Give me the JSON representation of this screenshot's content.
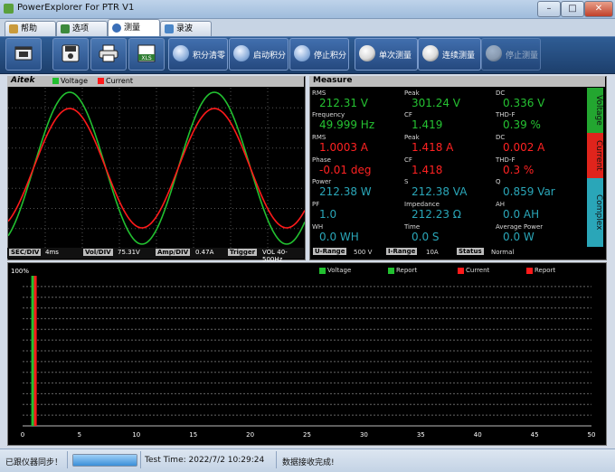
{
  "window": {
    "title": "PowerExplorer For PTR V1",
    "minimize": "–",
    "maximize": "□",
    "close": "✕"
  },
  "tabs": [
    {
      "label": "帮助",
      "icon": "help-icon"
    },
    {
      "label": "选项",
      "icon": "options-icon"
    },
    {
      "label": "测量",
      "icon": "measure-icon"
    },
    {
      "label": "录波",
      "icon": "record-icon"
    }
  ],
  "toolbar": {
    "icons": [
      "open-icon",
      "save-icon",
      "print-icon",
      "excel-export-icon"
    ],
    "excel_text": "XLS",
    "buttons": [
      {
        "label": "积分清零"
      },
      {
        "label": "启动积分"
      },
      {
        "label": "停止积分"
      },
      {
        "label": "单次测量"
      },
      {
        "label": "连续测量"
      },
      {
        "label": "停止测量"
      }
    ]
  },
  "waveform": {
    "brand": "Aitek",
    "legend": [
      {
        "name": "Voltage",
        "color": "#22c030"
      },
      {
        "name": "Current",
        "color": "#ff1a1a"
      }
    ],
    "footer": {
      "sec_label": "SEC/DIV",
      "sec_value": "4ms",
      "vol_label": "Vol/DIV",
      "vol_value": "75.31V",
      "amp_label": "Amp/DIV",
      "amp_value": "0.47A",
      "trig_label": "Trigger",
      "trig_value": "VOL 40-500Hz"
    }
  },
  "measure": {
    "title": "Measure",
    "side_tabs": {
      "voltage": "Voltage",
      "current": "Current",
      "complex": "Complex"
    },
    "voltage": {
      "rms_label": "RMS",
      "rms": "212.31 V",
      "peak_label": "Peak",
      "peak": "301.24 V",
      "dc_label": "DC",
      "dc": "0.336 V",
      "freq_label": "Frequency",
      "freq": "49.999 Hz",
      "cf_label": "CF",
      "cf": "1.419",
      "thd_label": "THD-F",
      "thd": "0.39 %"
    },
    "current": {
      "rms_label": "RMS",
      "rms": "1.0003 A",
      "peak_label": "Peak",
      "peak": "1.418 A",
      "dc_label": "DC",
      "dc": "0.002 A",
      "phase_label": "Phase",
      "phase": "-0.01 deg",
      "cf_label": "CF",
      "cf": "1.418",
      "thd_label": "THD-F",
      "thd": "0.3 %"
    },
    "complex": {
      "power_label": "Power",
      "power": "212.38 W",
      "s_label": "S",
      "s": "212.38 VA",
      "q_label": "Q",
      "q": "0.859 Var",
      "pf_label": "PF",
      "pf": "1.0",
      "imp_label": "Impedance",
      "imp": "212.23 Ω",
      "ah_label": "AH",
      "ah": "0.0 AH",
      "wh_label": "WH",
      "wh": "0.0 WH",
      "time_label": "Time",
      "time": "0.0 S",
      "avgp_label": "Average Power",
      "avgp": "0.0 W"
    },
    "footer": {
      "urange_label": "U-Range",
      "urange": "500 V",
      "irange_label": "I-Range",
      "irange": "10A",
      "status_label": "Status",
      "status": "Normal"
    }
  },
  "harmonics": {
    "ytop": "100%",
    "legend": [
      {
        "name": "Voltage",
        "color": "#22c030"
      },
      {
        "name": "Report",
        "color": "#22c030"
      },
      {
        "name": "Current",
        "color": "#ff1a1a"
      },
      {
        "name": "Report",
        "color": "#ff1a1a"
      }
    ]
  },
  "chart_data": {
    "type": "bar",
    "x": [
      0,
      5,
      10,
      15,
      20,
      25,
      30,
      35,
      40,
      45,
      50
    ],
    "xlim": [
      0,
      50
    ],
    "ylim": [
      0,
      100
    ],
    "ytick_label": "100%",
    "series": [
      {
        "name": "Voltage",
        "color": "#22c030",
        "values": [
          {
            "x": 1,
            "y": 100
          }
        ]
      },
      {
        "name": "Current",
        "color": "#ff1a1a",
        "values": [
          {
            "x": 1,
            "y": 100
          }
        ]
      }
    ]
  },
  "status": {
    "left": "已跟仪器同步！",
    "progress": 1.0,
    "test_time": "Test Time: 2022/7/2 10:29:24",
    "message": "数据接收完成!"
  }
}
